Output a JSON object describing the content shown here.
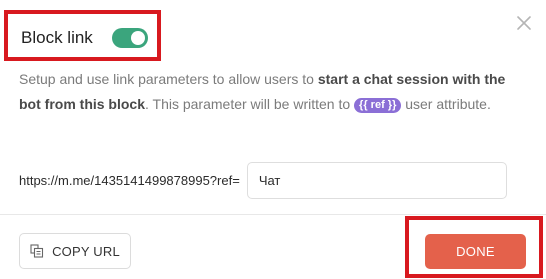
{
  "dialog": {
    "title": "Block link",
    "toggle_on": true,
    "description": {
      "part1": "Setup and use link parameters to allow users to ",
      "bold": "start a chat session with the bot from this block",
      "part2": ". This parameter will be written to ",
      "ref_tag": "{{ ref }}",
      "part3": " user attribute."
    },
    "url_prefix": "https://m.me/1435141499878995?ref=",
    "ref_value": "Чат",
    "copy_label": "COPY URL",
    "done_label": "DONE",
    "colors": {
      "toggle": "#3ba57d",
      "done": "#e4614b",
      "ref_pill": "#8b6fd6",
      "highlight": "#d8191f"
    },
    "icons": {
      "close": "close-icon",
      "copy": "copy-icon"
    }
  }
}
